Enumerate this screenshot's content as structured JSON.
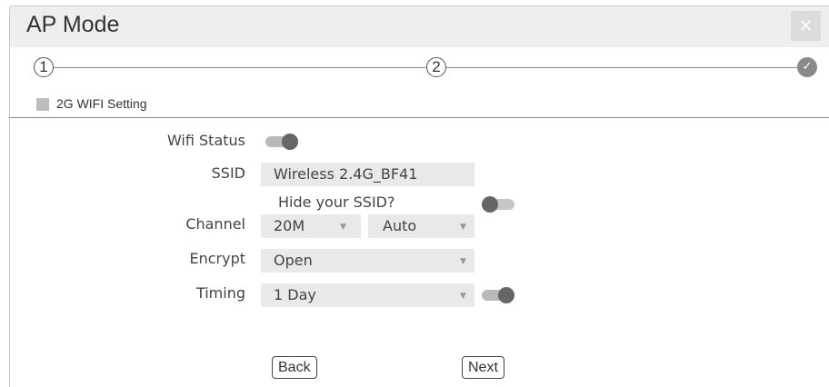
{
  "dialog": {
    "title": "AP Mode",
    "close_glyph": "×"
  },
  "steps": {
    "step1": "1",
    "step2": "2",
    "step3_icon": "check-icon",
    "check_glyph": "✓"
  },
  "section": {
    "title": "2G WIFI Setting"
  },
  "form": {
    "wifi_status": {
      "label": "Wifi Status",
      "enabled": true
    },
    "ssid": {
      "label": "SSID",
      "value": "Wireless 2.4G_BF41"
    },
    "hide_ssid": {
      "label": "Hide your SSID?",
      "enabled": false
    },
    "channel": {
      "label": "Channel",
      "width_value": "20M",
      "channel_value": "Auto"
    },
    "encrypt": {
      "label": "Encrypt",
      "value": "Open"
    },
    "timing": {
      "label": "Timing",
      "value": "1 Day",
      "enabled": true
    }
  },
  "buttons": {
    "back": "Back",
    "next": "Next"
  },
  "colors": {
    "titlebar": "#eeeeee",
    "field_bg": "#e9e9e9",
    "toggle_knob": "#666666"
  }
}
